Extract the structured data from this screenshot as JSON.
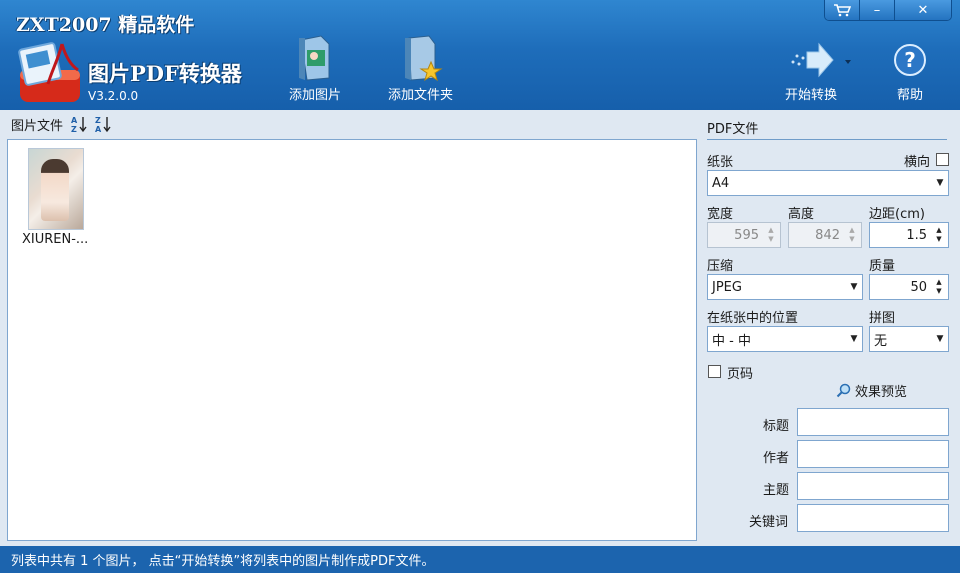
{
  "window": {
    "brand": "ZXT2007 精品软件",
    "product": "图片PDF转换器",
    "version": "V3.2.0.0",
    "controls": {
      "cart": "cart-icon",
      "minimize": "–",
      "close": "✕"
    }
  },
  "toolbar": {
    "add_image": "添加图片",
    "add_folder": "添加文件夹",
    "start": "开始转换",
    "help": "帮助"
  },
  "left": {
    "header": "图片文件",
    "items": [
      {
        "label": "XIUREN-..."
      }
    ]
  },
  "right": {
    "title": "PDF文件",
    "paper_label": "纸张",
    "landscape_label": "横向",
    "paper_value": "A4",
    "width_label": "宽度",
    "height_label": "高度",
    "margin_label": "边距(cm)",
    "width_value": "595",
    "height_value": "842",
    "margin_value": "1.5",
    "compress_label": "压缩",
    "quality_label": "质量",
    "compress_value": "JPEG",
    "quality_value": "50",
    "position_label": "在纸张中的位置",
    "tile_label": "拼图",
    "position_value": "中 - 中",
    "tile_value": "无",
    "page_number_label": "页码",
    "preview_label": "效果预览",
    "meta_title": "标题",
    "meta_author": "作者",
    "meta_subject": "主题",
    "meta_keywords": "关键词"
  },
  "status": {
    "text": "列表中共有 1 个图片， 点击“开始转换”将列表中的图片制作成PDF文件。"
  },
  "colors": {
    "titlebar": "#1e6dba",
    "panel": "#dfe8f2",
    "status": "#1c64ae"
  }
}
